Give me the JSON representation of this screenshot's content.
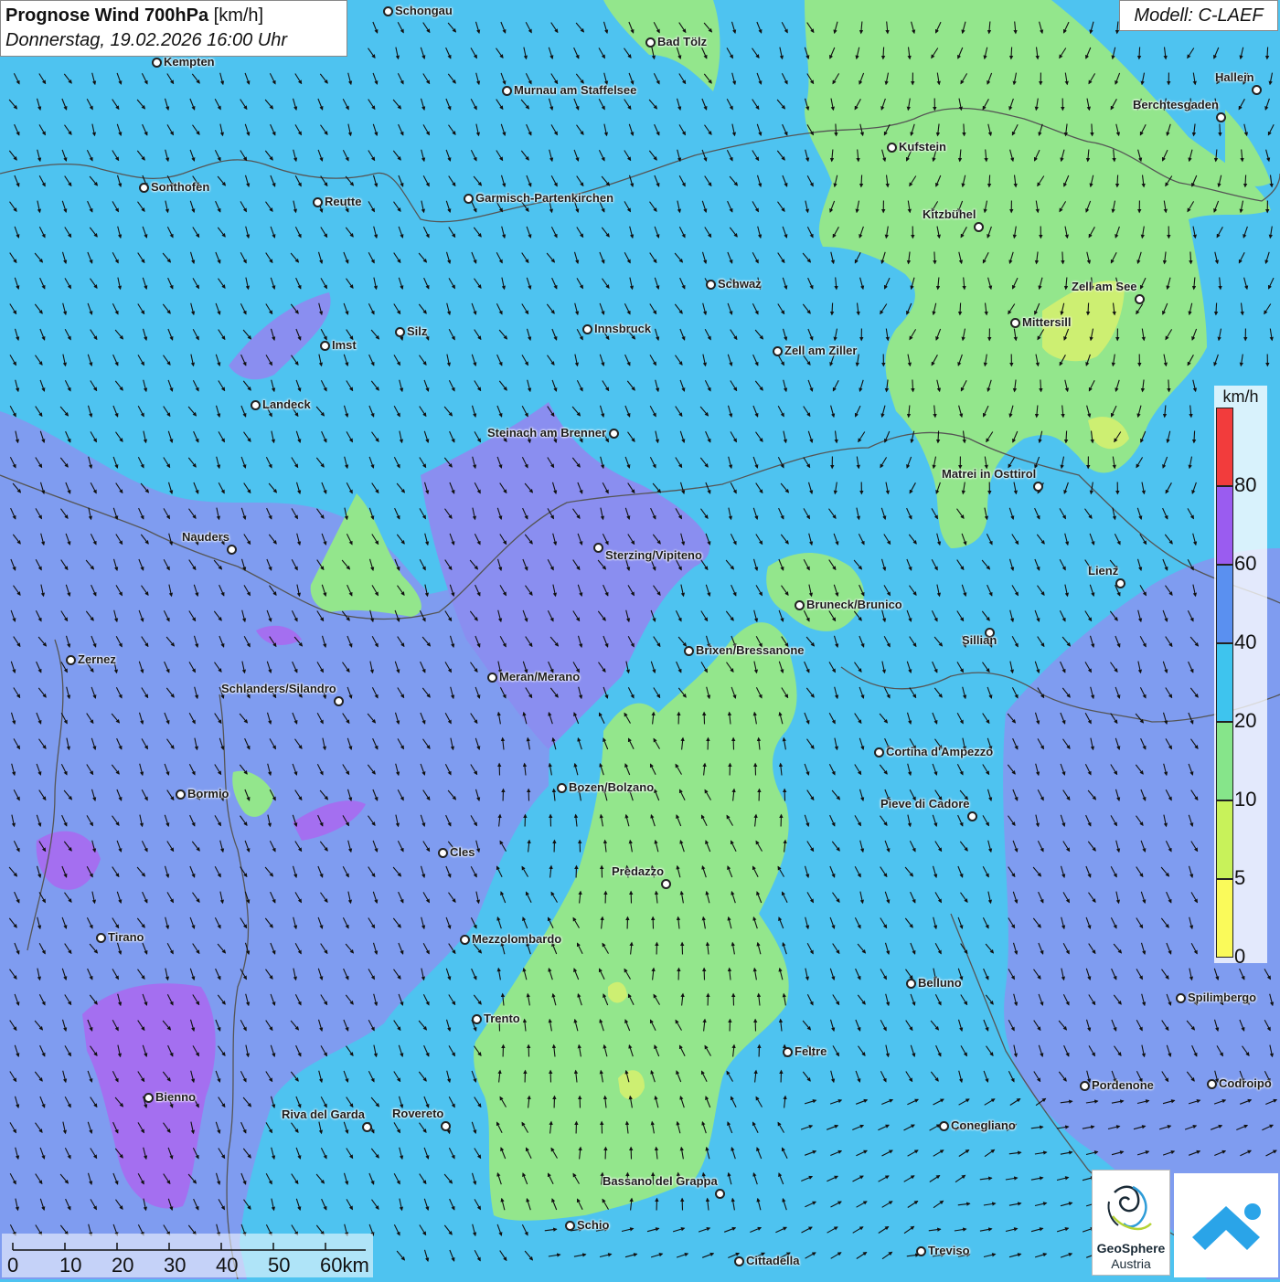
{
  "header": {
    "title_main": "Prognose Wind 700hPa",
    "title_unit": "[km/h]",
    "datetime": "Donnerstag, 19.02.2026 16:00 Uhr",
    "model": "Modell: C-LAEF"
  },
  "legend": {
    "unit": "km/h",
    "bins": [
      {
        "label": "80",
        "color": "#f23c3c"
      },
      {
        "label": "60",
        "color": "#9a5cf0"
      },
      {
        "label": "40",
        "color": "#5a90f0"
      },
      {
        "label": "20",
        "color": "#3ec4ee"
      },
      {
        "label": "10",
        "color": "#86e58a"
      },
      {
        "label": "5",
        "color": "#c8f25a"
      },
      {
        "label": "0",
        "color": "#fafa5a"
      }
    ]
  },
  "scalebar": {
    "labels": [
      "0",
      "10",
      "20",
      "30",
      "40",
      "50",
      "60km"
    ]
  },
  "logos": {
    "geosphere_name": "GeoSphere",
    "geosphere_sub": "Austria"
  },
  "colors": {
    "base": "#4ec3f0",
    "purple_light": "#7f9cf0",
    "purple": "#8c78ee",
    "violet": "#a46ff0",
    "green": "#93e68c",
    "yellow_green": "#cdef72",
    "border": "#555555"
  },
  "cities": [
    {
      "name": "Schongau"
    },
    {
      "name": "Bad Tölz"
    },
    {
      "name": "Kempten"
    },
    {
      "name": "Murnau am Staffelsee"
    },
    {
      "name": "Hallein"
    },
    {
      "name": "Berchtesgaden"
    },
    {
      "name": "Kufstein"
    },
    {
      "name": "Sonthofen"
    },
    {
      "name": "Reutte"
    },
    {
      "name": "Garmisch-Partenkirchen"
    },
    {
      "name": "Kitzbühel"
    },
    {
      "name": "Schwaz"
    },
    {
      "name": "Zell am See"
    },
    {
      "name": "Innsbruck"
    },
    {
      "name": "Mittersill"
    },
    {
      "name": "Silz"
    },
    {
      "name": "Imst"
    },
    {
      "name": "Zell am Ziller"
    },
    {
      "name": "Landeck"
    },
    {
      "name": "Steinach am Brenner"
    },
    {
      "name": "Matrei in Osttirol"
    },
    {
      "name": "Nauders"
    },
    {
      "name": "Sterzing/Vipiteno"
    },
    {
      "name": "Lienz"
    },
    {
      "name": "Bruneck/Brunico"
    },
    {
      "name": "Sillian"
    },
    {
      "name": "Brixen/Bressanone"
    },
    {
      "name": "Zernez"
    },
    {
      "name": "Meran/Merano"
    },
    {
      "name": "Schlanders/Silandro"
    },
    {
      "name": "Cortina d'Ampezzo"
    },
    {
      "name": "Bozen/Bolzano"
    },
    {
      "name": "Bormio"
    },
    {
      "name": "Pieve di Cadore"
    },
    {
      "name": "Cles"
    },
    {
      "name": "Predazzo"
    },
    {
      "name": "Tirano"
    },
    {
      "name": "Mezzolombardo"
    },
    {
      "name": "Belluno"
    },
    {
      "name": "Spilimbergo"
    },
    {
      "name": "Trento"
    },
    {
      "name": "Feltre"
    },
    {
      "name": "Pordenone"
    },
    {
      "name": "Codroipo"
    },
    {
      "name": "Bienno"
    },
    {
      "name": "Riva del Garda"
    },
    {
      "name": "Rovereto"
    },
    {
      "name": "Conegliano"
    },
    {
      "name": "Bassano del Grappa"
    },
    {
      "name": "Schio"
    },
    {
      "name": "Treviso"
    },
    {
      "name": "Cittadella"
    }
  ]
}
